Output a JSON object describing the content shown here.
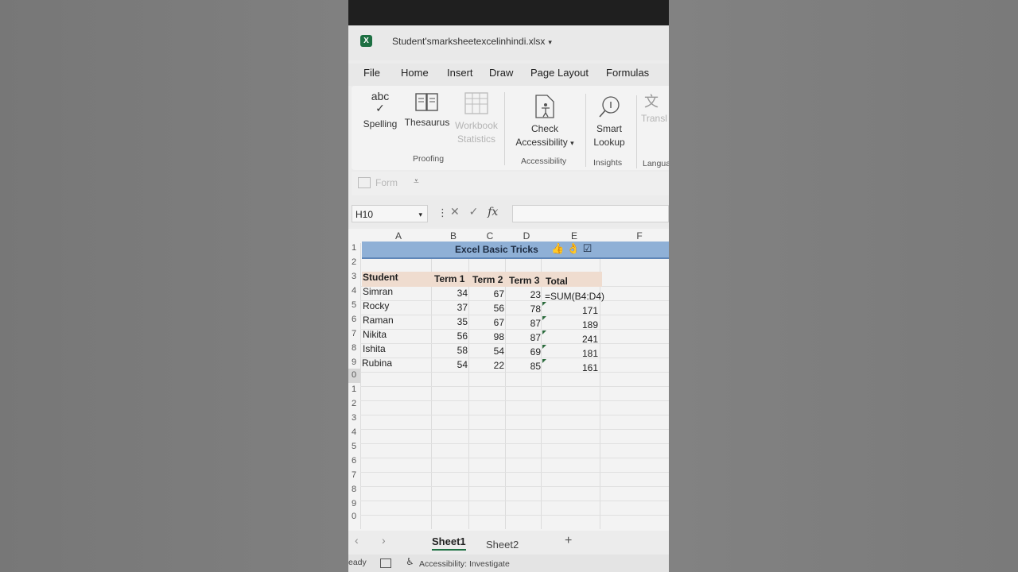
{
  "app": {
    "title": "Student'smarksheetexcelinhindi.xlsx",
    "logo_letter": "X"
  },
  "menu": {
    "tabs": [
      "File",
      "Home",
      "Insert",
      "Draw",
      "Page Layout",
      "Formulas"
    ]
  },
  "ribbon": {
    "spelling": "Spelling",
    "spelling_icon_text": "abc",
    "thesaurus": "Thesaurus",
    "workbook_stats_1": "Workbook",
    "workbook_stats_2": "Statistics",
    "proofing": "Proofing",
    "check_1": "Check",
    "check_2": "Accessibility",
    "accessibility": "Accessibility",
    "smart_1": "Smart",
    "smart_2": "Lookup",
    "insights": "Insights",
    "translate": "Transl",
    "language": "Langua"
  },
  "quick_access": {
    "form": "Form"
  },
  "formula_bar": {
    "name_box": "H10",
    "fx": "fx"
  },
  "sheet": {
    "columns": [
      "A",
      "B",
      "C",
      "D",
      "E",
      "F"
    ],
    "rows": [
      "1",
      "2",
      "3",
      "4",
      "5",
      "6",
      "7",
      "8",
      "9",
      "0",
      "1",
      "2",
      "3",
      "4",
      "5",
      "6",
      "7",
      "8",
      "9",
      "0"
    ],
    "banner": "Excel Basic Tricks",
    "headers": [
      "Student",
      "Term 1",
      "Term 2",
      "Term 3",
      "Total"
    ],
    "data": [
      {
        "name": "Simran",
        "t1": "34",
        "t2": "67",
        "t3": "23",
        "total": "=SUM(B4:D4)"
      },
      {
        "name": "Rocky",
        "t1": "37",
        "t2": "56",
        "t3": "78",
        "total": "171"
      },
      {
        "name": "Raman",
        "t1": "35",
        "t2": "67",
        "t3": "87",
        "total": "189"
      },
      {
        "name": "Nikita",
        "t1": "56",
        "t2": "98",
        "t3": "87",
        "total": "241"
      },
      {
        "name": "Ishita",
        "t1": "58",
        "t2": "54",
        "t3": "69",
        "total": "181"
      },
      {
        "name": "Rubina",
        "t1": "54",
        "t2": "22",
        "t3": "85",
        "total": "161"
      }
    ]
  },
  "sheet_tabs": {
    "tabs": [
      "Sheet1",
      "Sheet2"
    ],
    "active": "Sheet1"
  },
  "status": {
    "ready": "eady",
    "accessibility": "Accessibility: Investigate"
  },
  "colors": {
    "banner": "#8fb0d6",
    "header_band": "#efdccf",
    "excel_green": "#1d6f42"
  }
}
